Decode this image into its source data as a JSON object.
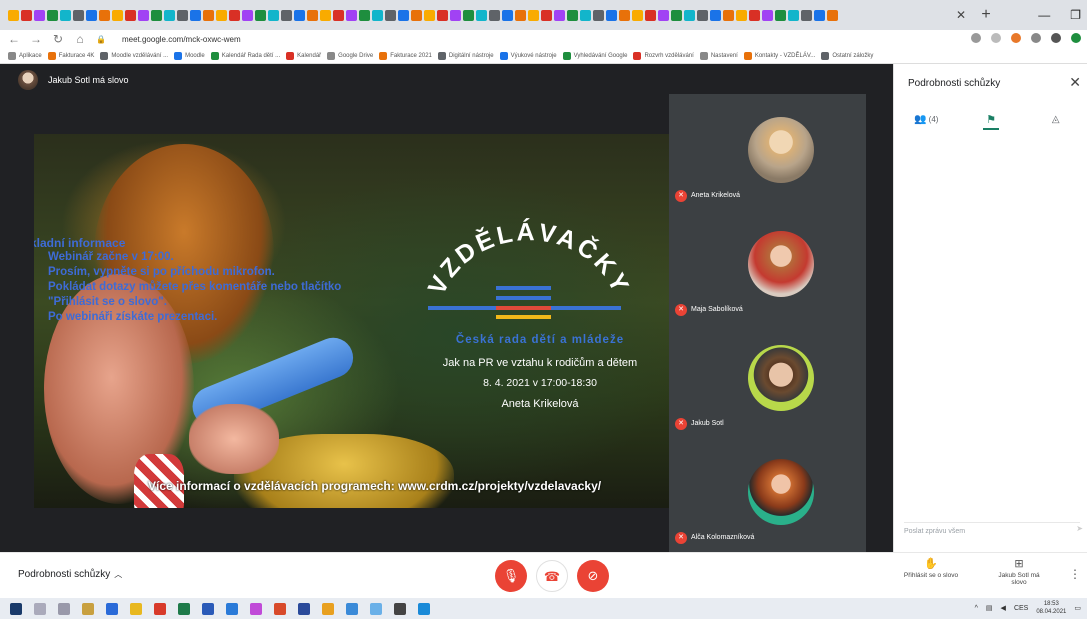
{
  "browser": {
    "url": "meet.google.com/mck-oxwc-wem",
    "bookmarks": [
      "Aplikace",
      "Fakturace 4K",
      "Moodle vzdělávání ...",
      "Moodle",
      "Kalendář Rada dětí ...",
      "Kalendář",
      "Google Drive",
      "Fakturace 2021",
      "Digitální nástroje",
      "Výukové nástroje",
      "Vyhledávání Google",
      "Rozvrh vzdělávání",
      "Nastavení",
      "Kontakty - VZDĚLÁV...",
      "Ostatní záložky"
    ]
  },
  "meet": {
    "speaker_label": "Jakub Sotl má slovo",
    "slide": {
      "info_title": "Základní informace",
      "info_items": [
        "Webinář začne v 17:00.",
        "Prosím, vypněte si po příchodu mikrofon.",
        "Pokládat dotazy můžete přes komentáře nebo tlačítko \"Přihlásit se o slovo\".",
        "Po webináři získáte prezentaci."
      ],
      "logo_word": "VZDĚLÁVAČKY",
      "council": "Česká rada dětí a mládeže",
      "event_title": "Jak na PR ve vztahu k rodičům a dětem",
      "event_date": "8. 4. 2021 v 17:00-18:30",
      "event_speaker": "Aneta Krikelová",
      "more_info": "Více informací o vzdělávacích programech: www.crdm.cz/projekty/vzdelavacky/"
    },
    "participants": [
      {
        "name": "Aneta Krikelová"
      },
      {
        "name": "Maja Sabolíková"
      },
      {
        "name": "Jakub Sotl"
      },
      {
        "name": "Alča Kolomazníková"
      }
    ]
  },
  "panel": {
    "title": "Podrobnosti schůzky",
    "tab_people_count": "(4)",
    "message_placeholder": "Poslat zprávu všem"
  },
  "controls": {
    "details_label": "Podrobnosti schůzky",
    "raise_hand_label": "Přihlásit se o slovo",
    "presenting_label": "Jakub Sotl má slovo"
  },
  "taskbar": {
    "language": "CES",
    "time": "18:53",
    "date": "08.04.2021"
  }
}
